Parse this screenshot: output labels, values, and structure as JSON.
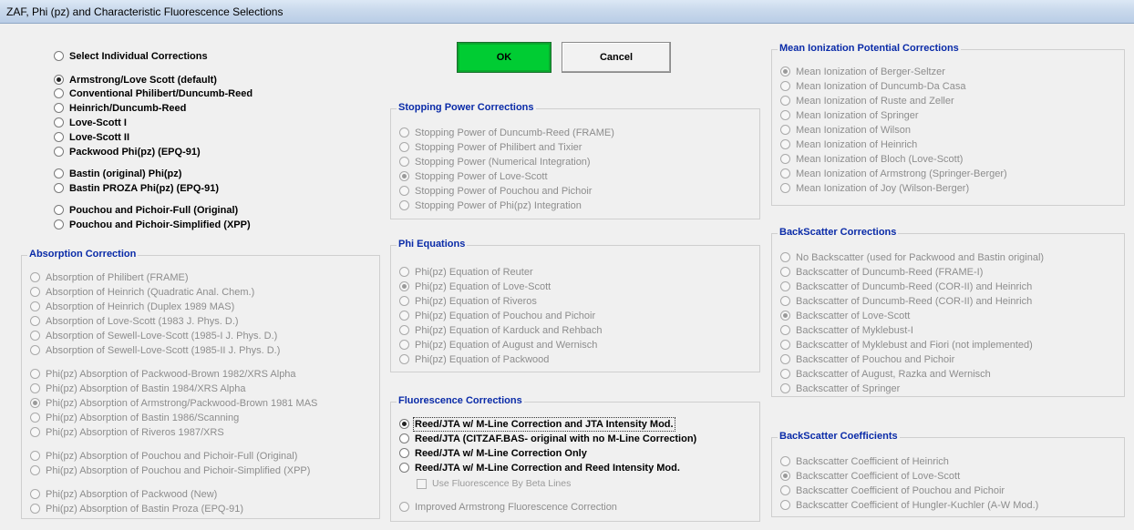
{
  "window": {
    "title": "ZAF, Phi (pz) and Characteristic Fluorescence Selections"
  },
  "buttons": {
    "ok": "OK",
    "cancel": "Cancel"
  },
  "main_options": [
    {
      "label": "Select Individual Corrections",
      "checked": false
    },
    {
      "label": "Armstrong/Love Scott (default)",
      "checked": true
    },
    {
      "label": "Conventional Philibert/Duncumb-Reed",
      "checked": false
    },
    {
      "label": "Heinrich/Duncumb-Reed",
      "checked": false
    },
    {
      "label": "Love-Scott I",
      "checked": false
    },
    {
      "label": "Love-Scott II",
      "checked": false
    },
    {
      "label": "Packwood Phi(pz) (EPQ-91)",
      "checked": false
    },
    {
      "label": "Bastin (original) Phi(pz)",
      "checked": false
    },
    {
      "label": "Bastin PROZA Phi(pz) (EPQ-91)",
      "checked": false
    },
    {
      "label": "Pouchou and Pichoir-Full (Original)",
      "checked": false
    },
    {
      "label": "Pouchou and Pichoir-Simplified (XPP)",
      "checked": false
    }
  ],
  "absorption": {
    "title": "Absorption Correction",
    "options": [
      {
        "label": "Absorption of Philibert (FRAME)",
        "checked": false
      },
      {
        "label": "Absorption of Heinrich (Quadratic Anal. Chem.)",
        "checked": false
      },
      {
        "label": "Absorption of Heinrich (Duplex 1989 MAS)",
        "checked": false
      },
      {
        "label": "Absorption of Love-Scott (1983 J. Phys. D.)",
        "checked": false
      },
      {
        "label": "Absorption of Sewell-Love-Scott (1985-I J. Phys. D.)",
        "checked": false
      },
      {
        "label": "Absorption of Sewell-Love-Scott (1985-II J. Phys. D.)",
        "checked": false
      },
      {
        "label": "Phi(pz) Absorption of Packwood-Brown 1982/XRS Alpha",
        "checked": false
      },
      {
        "label": "Phi(pz) Absorption of Bastin 1984/XRS Alpha",
        "checked": false
      },
      {
        "label": "Phi(pz) Absorption of Armstrong/Packwood-Brown 1981 MAS",
        "checked": true
      },
      {
        "label": "Phi(pz) Absorption of Bastin 1986/Scanning",
        "checked": false
      },
      {
        "label": "Phi(pz) Absorption of Riveros 1987/XRS",
        "checked": false
      },
      {
        "label": "Phi(pz) Absorption of Pouchou and Pichoir-Full (Original)",
        "checked": false
      },
      {
        "label": "Phi(pz) Absorption of Pouchou and Pichoir-Simplified (XPP)",
        "checked": false
      },
      {
        "label": "Phi(pz) Absorption of Packwood (New)",
        "checked": false
      },
      {
        "label": "Phi(pz) Absorption of Bastin Proza (EPQ-91)",
        "checked": false
      }
    ]
  },
  "stopping_power": {
    "title": "Stopping Power Corrections",
    "options": [
      {
        "label": "Stopping Power of Duncumb-Reed (FRAME)",
        "checked": false
      },
      {
        "label": "Stopping Power of Philibert and Tixier",
        "checked": false
      },
      {
        "label": "Stopping Power (Numerical Integration)",
        "checked": false
      },
      {
        "label": "Stopping Power of Love-Scott",
        "checked": true
      },
      {
        "label": "Stopping Power of Pouchou and Pichoir",
        "checked": false
      },
      {
        "label": "Stopping Power of Phi(pz) Integration",
        "checked": false
      }
    ]
  },
  "phi_equations": {
    "title": "Phi Equations",
    "options": [
      {
        "label": "Phi(pz) Equation of Reuter",
        "checked": false
      },
      {
        "label": "Phi(pz) Equation of Love-Scott",
        "checked": true
      },
      {
        "label": "Phi(pz) Equation of Riveros",
        "checked": false
      },
      {
        "label": "Phi(pz) Equation of Pouchou and Pichoir",
        "checked": false
      },
      {
        "label": "Phi(pz) Equation of Karduck and Rehbach",
        "checked": false
      },
      {
        "label": "Phi(pz) Equation of August and Wernisch",
        "checked": false
      },
      {
        "label": "Phi(pz) Equation of Packwood",
        "checked": false
      }
    ]
  },
  "fluorescence": {
    "title": "Fluorescence Corrections",
    "options": [
      {
        "label": "Reed/JTA w/ M-Line Correction and JTA Intensity Mod.",
        "checked": true
      },
      {
        "label": "Reed/JTA (CITZAF.BAS- original with no M-Line Correction)",
        "checked": false
      },
      {
        "label": "Reed/JTA w/ M-Line Correction Only",
        "checked": false
      },
      {
        "label": "Reed/JTA w/ M-Line Correction and Reed Intensity Mod.",
        "checked": false
      }
    ],
    "beta_checkbox": "Use Fluorescence By Beta Lines",
    "improved": "Improved Armstrong Fluorescence Correction"
  },
  "mean_ionization": {
    "title": "Mean Ionization Potential Corrections",
    "options": [
      {
        "label": "Mean Ionization of Berger-Seltzer",
        "checked": true
      },
      {
        "label": "Mean Ionization of Duncumb-Da Casa",
        "checked": false
      },
      {
        "label": "Mean Ionization of Ruste and Zeller",
        "checked": false
      },
      {
        "label": "Mean Ionization of Springer",
        "checked": false
      },
      {
        "label": "Mean Ionization of Wilson",
        "checked": false
      },
      {
        "label": "Mean Ionization of Heinrich",
        "checked": false
      },
      {
        "label": "Mean Ionization of Bloch (Love-Scott)",
        "checked": false
      },
      {
        "label": "Mean Ionization of Armstrong (Springer-Berger)",
        "checked": false
      },
      {
        "label": "Mean Ionization of Joy (Wilson-Berger)",
        "checked": false
      }
    ]
  },
  "backscatter": {
    "title": "BackScatter Corrections",
    "options": [
      {
        "label": "No Backscatter (used for Packwood and Bastin original)",
        "checked": false
      },
      {
        "label": "Backscatter of Duncumb-Reed (FRAME-I)",
        "checked": false
      },
      {
        "label": "Backscatter of Duncumb-Reed (COR-II) and Heinrich",
        "checked": false
      },
      {
        "label": "Backscatter of Duncumb-Reed (COR-II) and Heinrich",
        "checked": false
      },
      {
        "label": "Backscatter of Love-Scott",
        "checked": true
      },
      {
        "label": "Backscatter of Myklebust-I",
        "checked": false
      },
      {
        "label": "Backscatter of Myklebust and Fiori (not implemented)",
        "checked": false
      },
      {
        "label": "Backscatter of Pouchou and Pichoir",
        "checked": false
      },
      {
        "label": "Backscatter of August, Razka and Wernisch",
        "checked": false
      },
      {
        "label": "Backscatter of Springer",
        "checked": false
      }
    ]
  },
  "backscatter_coeff": {
    "title": "BackScatter Coefficients",
    "options": [
      {
        "label": "Backscatter Coefficient of Heinrich",
        "checked": false
      },
      {
        "label": "Backscatter Coefficient of Love-Scott",
        "checked": true
      },
      {
        "label": "Backscatter Coefficient of Pouchou and Pichoir",
        "checked": false
      },
      {
        "label": "Backscatter Coefficient of Hungler-Kuchler (A-W Mod.)",
        "checked": false
      }
    ]
  }
}
